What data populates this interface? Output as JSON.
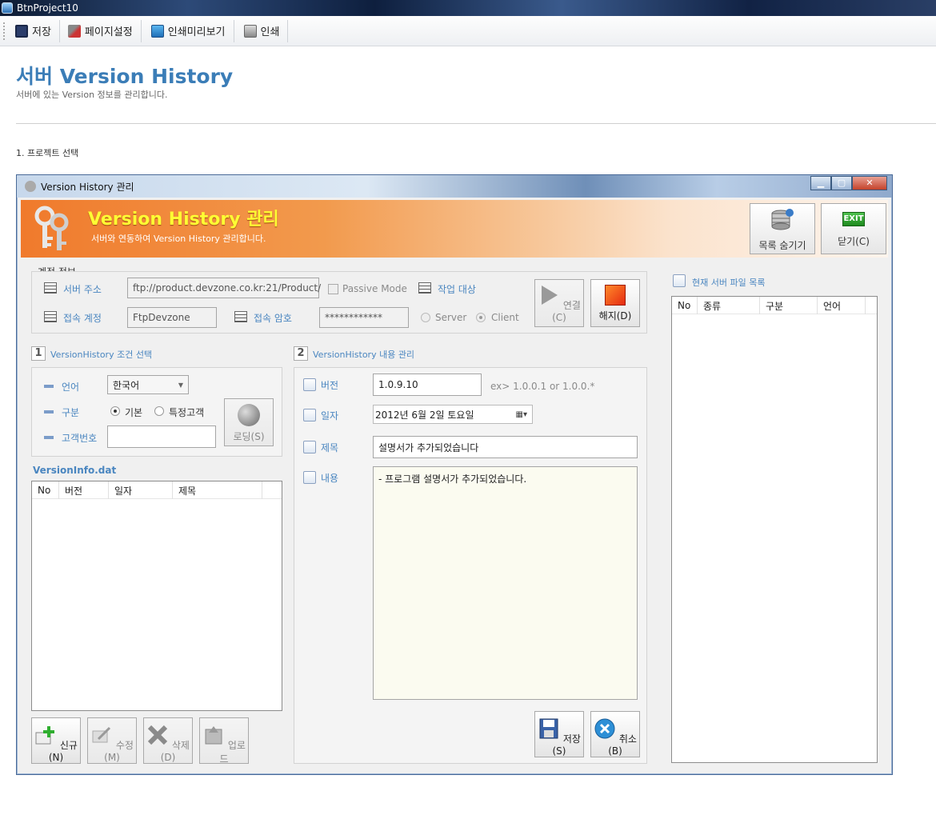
{
  "app": {
    "title": "BtnProject10"
  },
  "toolbar": {
    "save": "저장",
    "page_setup": "페이지설정",
    "print_preview": "인쇄미리보기",
    "print": "인쇄"
  },
  "page": {
    "title": "서버 Version History",
    "subtitle": "서버에 있는 Version 정보를 관리합니다.",
    "section": "1. 프로젝트 선택"
  },
  "window": {
    "title": "Version History 관리",
    "banner_title": "Version History 관리",
    "banner_sub": "서버와 연동하여 Version History 관리합니다.",
    "hide_list": "목록 숨기기",
    "close": "닫기(C)",
    "exit_badge": "EXIT"
  },
  "account": {
    "group": "계정 정보",
    "server_label": "서버 주소",
    "server_value": "ftp://product.devzone.co.kr:21/Product/",
    "passive": "Passive Mode",
    "target_label": "작업 대상",
    "user_label": "접속 계정",
    "user_value": "FtpDevzone",
    "pass_label": "접속 암호",
    "pass_value": "************",
    "server_opt": "Server",
    "client_opt": "Client",
    "connect": "연결(C)",
    "disconnect": "해지(D)"
  },
  "condition": {
    "title": "VersionHistory 조건 선택",
    "lang_label": "언어",
    "lang_value": "한국어",
    "type_label": "구분",
    "basic": "기본",
    "special": "특정고객",
    "cust_label": "고객번호",
    "loading": "로딩(S)"
  },
  "file_list": {
    "name": "VersionInfo.dat",
    "cols": [
      "No",
      "버전",
      "일자",
      "제목"
    ]
  },
  "list_buttons": {
    "new": "신규(N)",
    "edit": "수정(M)",
    "delete": "삭제(D)",
    "upload": "업로드"
  },
  "content": {
    "title": "VersionHistory 내용 관리",
    "version_label": "버전",
    "version_value": "1.0.9.10",
    "version_hint": "ex> 1.0.0.1 or 1.0.0.*",
    "date_label": "일자",
    "date_value": "2012년   6월   2일 토요일",
    "subject_label": "제목",
    "subject_value": "설명서가 추가되었습니다",
    "body_label": "내용",
    "body_value": "- 프로그램 설명서가 추가되었습니다.",
    "save": "저장(S)",
    "cancel": "취소(B)"
  },
  "server_files": {
    "title": "현재 서버 파일 목록",
    "cols": [
      "No",
      "종류",
      "구분",
      "언어"
    ]
  },
  "colors": {
    "accent_blue": "#3b7db7",
    "banner_orange": "#f07a2c",
    "banner_title": "#ffff33"
  }
}
